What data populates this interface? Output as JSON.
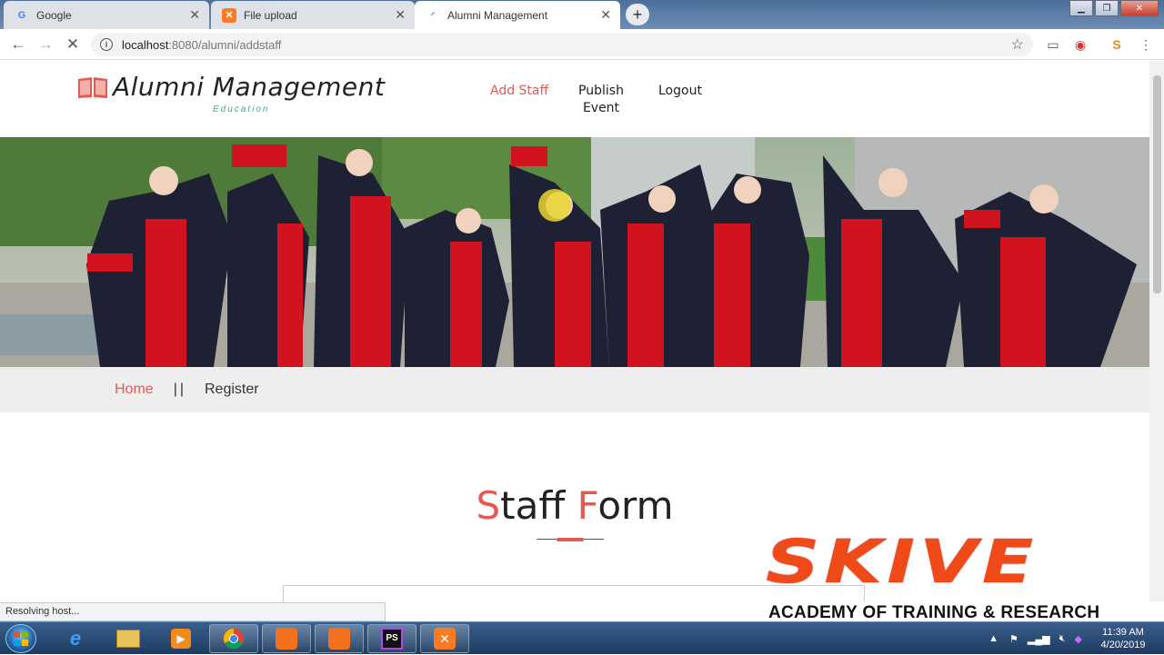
{
  "browser": {
    "tabs": [
      {
        "title": "Google",
        "icon": "google-icon",
        "active": false
      },
      {
        "title": "File upload",
        "icon": "xampp-icon",
        "active": false
      },
      {
        "title": "Alumni Management",
        "icon": "loading-icon",
        "active": true
      }
    ],
    "url_host": "localhost",
    "url_path": ":8080/alumni/addstaff",
    "status_text": "Resolving host..."
  },
  "site": {
    "logo_text": "Alumni Management",
    "logo_sub": "Education",
    "nav": [
      {
        "label": "Add Staff",
        "active": true
      },
      {
        "label": "Publish",
        "label2": "Event",
        "active": false
      },
      {
        "label": "Logout",
        "active": false
      }
    ],
    "breadcrumb": {
      "home": "Home",
      "sep": "||",
      "current": "Register"
    },
    "form_title": {
      "s": "S",
      "taff": "taff ",
      "f": "F",
      "orm": "orm"
    },
    "accent_color": "#e55a50"
  },
  "watermark": {
    "big": "SKIVE",
    "small": "ACADEMY OF TRAINING & RESEARCH"
  },
  "taskbar": {
    "time": "11:39 AM",
    "date": "4/20/2019"
  }
}
